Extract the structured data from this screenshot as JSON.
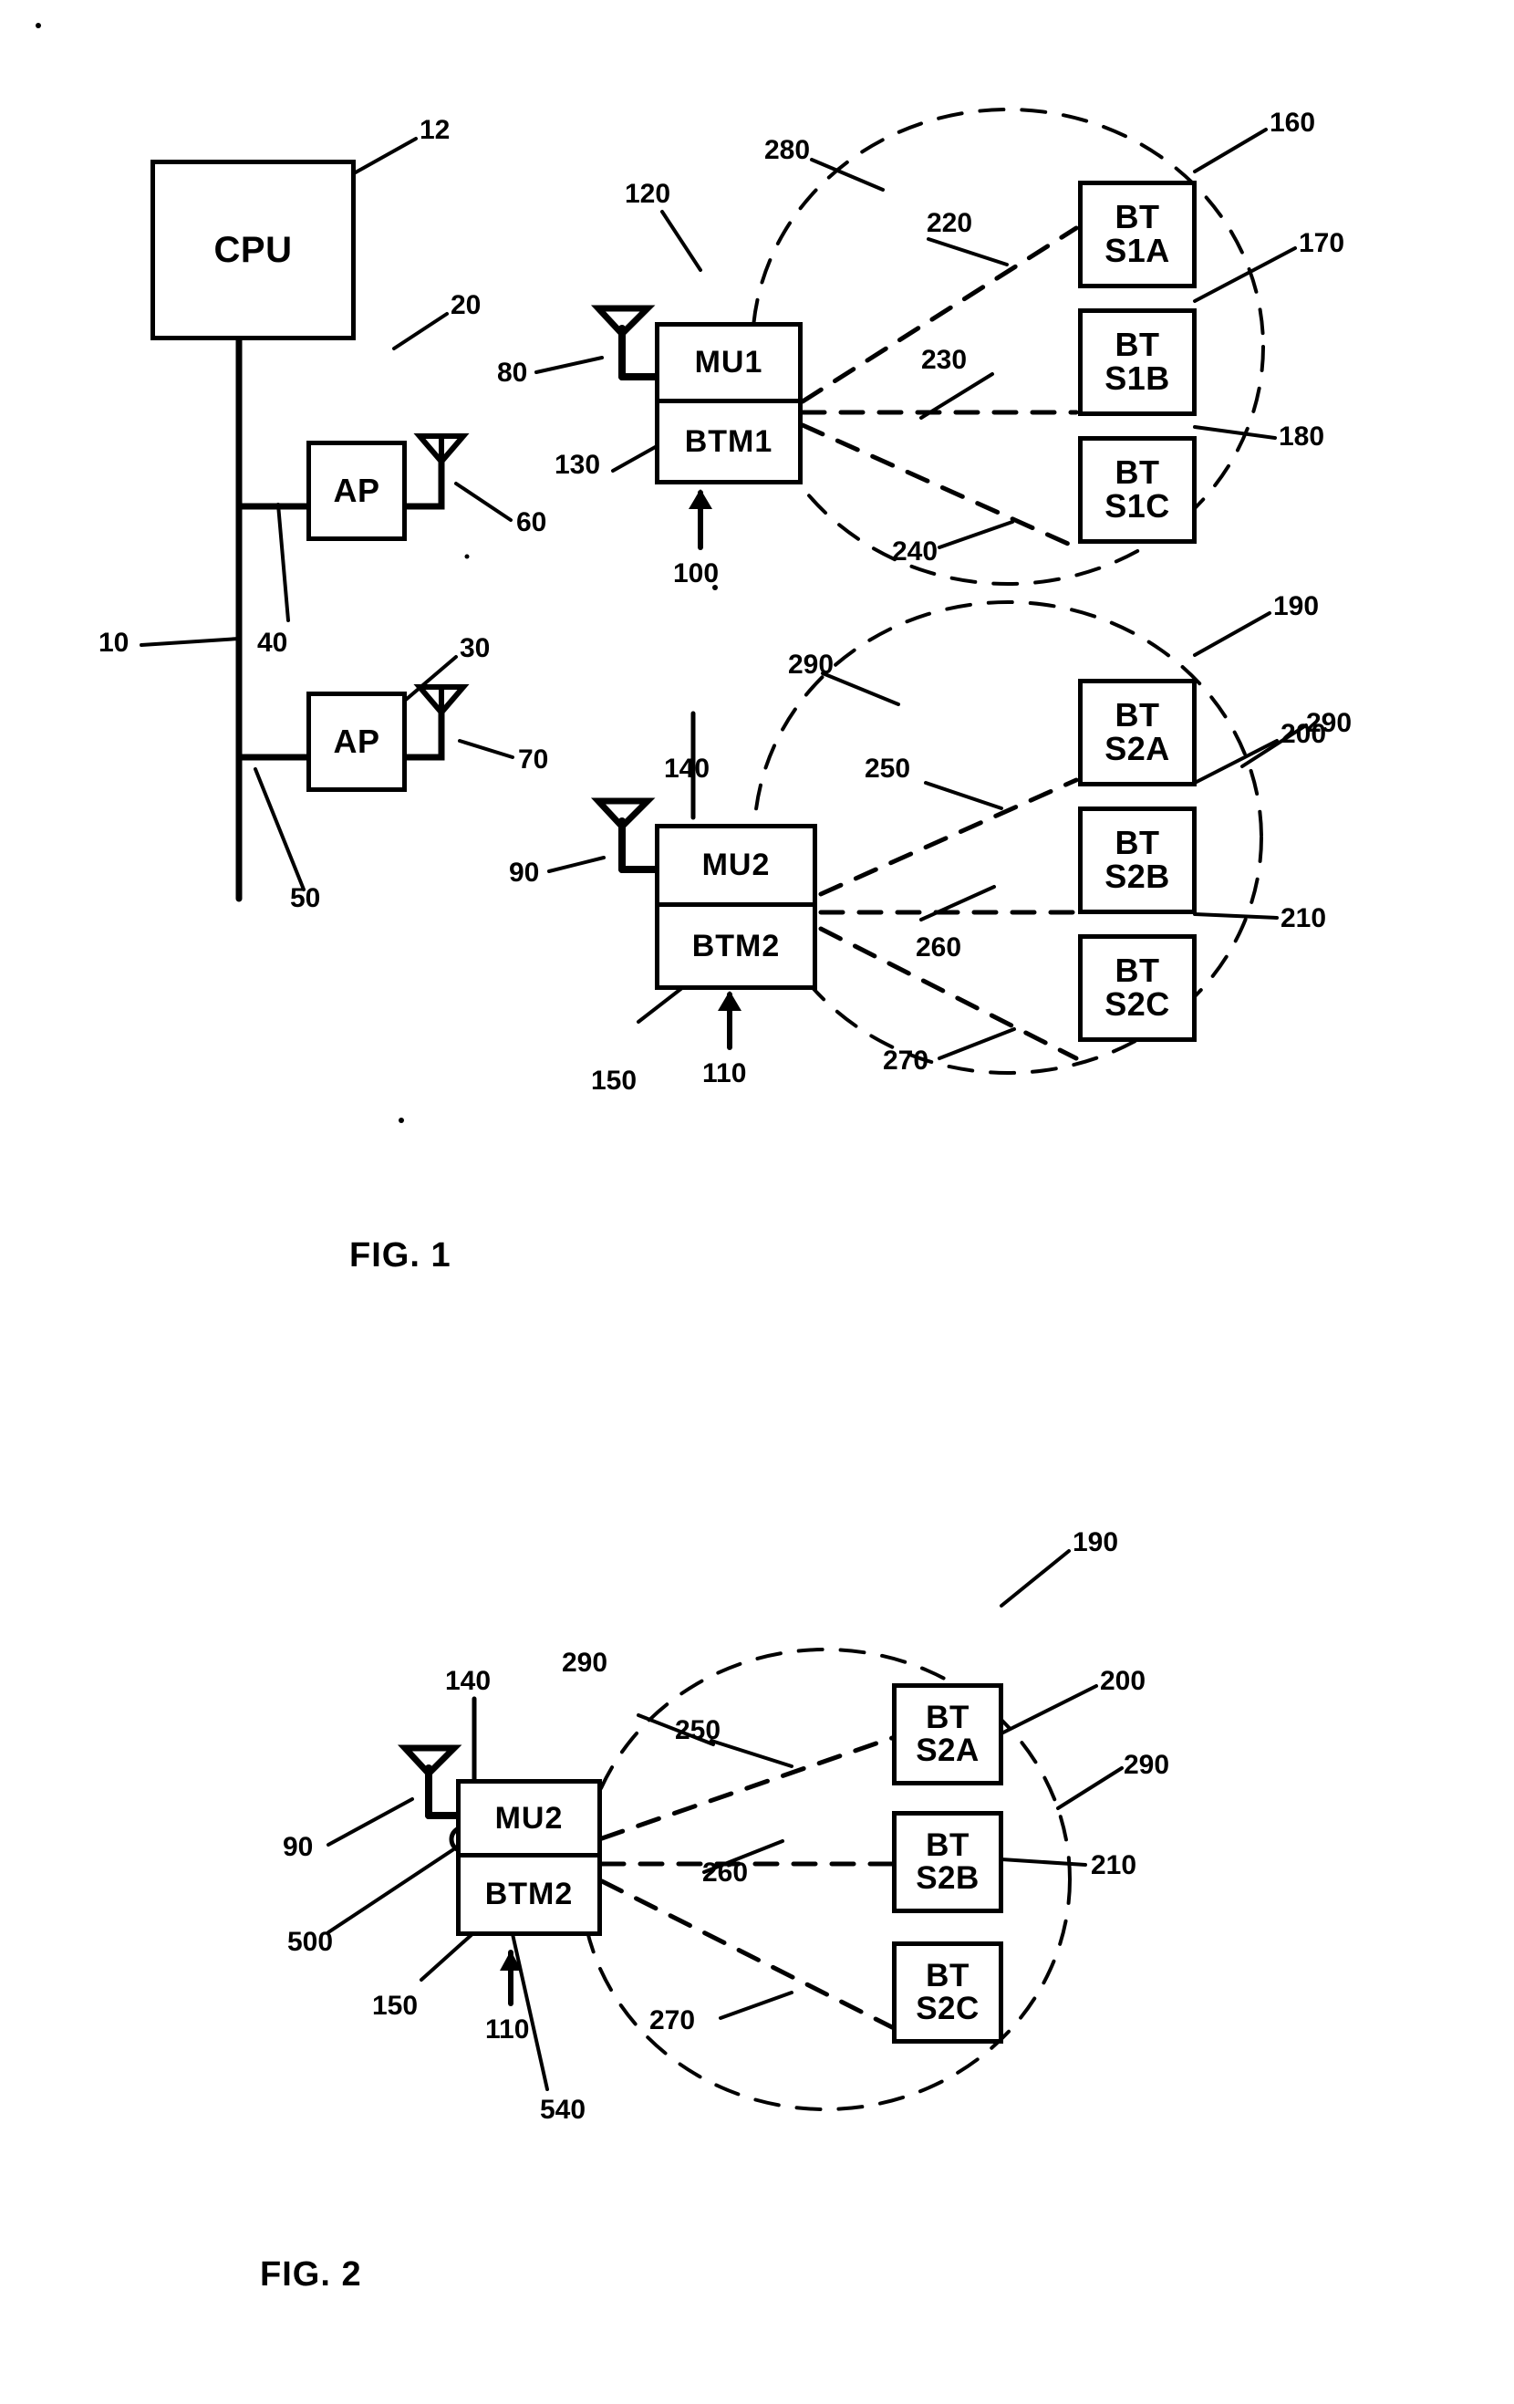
{
  "document": {
    "type": "patent-drawing-sheet",
    "figures": [
      {
        "caption": "FIG. 1",
        "blocks": {
          "cpu": "CPU",
          "ap1": "AP",
          "ap2": "AP",
          "mu1_top": "MU1",
          "mu1_bottom": "BTM1",
          "mu2_top": "MU2",
          "mu2_bottom": "BTM2",
          "bt_s1a_line1": "BT",
          "bt_s1a_line2": "S1A",
          "bt_s1b_line1": "BT",
          "bt_s1b_line2": "S1B",
          "bt_s1c_line1": "BT",
          "bt_s1c_line2": "S1C",
          "bt_s2a_line1": "BT",
          "bt_s2a_line2": "S2A",
          "bt_s2b_line1": "BT",
          "bt_s2b_line2": "S2B",
          "bt_s2c_line1": "BT",
          "bt_s2c_line2": "S2C"
        },
        "reference_numerals": {
          "cpu": "12",
          "ap1": "20",
          "ap2": "30",
          "bus": "10",
          "bus_tap_upper": "40",
          "bus_tap_lower": "50",
          "ap1_antenna": "60",
          "ap2_antenna": "70",
          "mu1_antenna": "80",
          "mu2_antenna": "90",
          "btm1_arrow": "100",
          "btm2_arrow": "110",
          "mu1": "120",
          "btm1": "130",
          "mu2": "140",
          "btm2": "150",
          "bt_s1a": "160",
          "bt_s1b": "170",
          "bt_s1c": "180",
          "bt_s2a": "190",
          "bt_s2b": "200",
          "bt_s2c": "210",
          "link_s1a": "220",
          "link_s1b": "230",
          "link_s1c": "240",
          "link_s2a": "250",
          "link_s2b": "260",
          "link_s2c": "270",
          "piconet1": "280",
          "piconet2_upper": "290",
          "piconet2_right": "290",
          "piconet2_lower": "290"
        }
      },
      {
        "caption": "FIG. 2",
        "blocks": {
          "mu2_top": "MU2",
          "mu2_bottom": "BTM2",
          "bt_s2a_line1": "BT",
          "bt_s2a_line2": "S2A",
          "bt_s2b_line1": "BT",
          "bt_s2b_line2": "S2B",
          "bt_s2c_line1": "BT",
          "bt_s2c_line2": "S2C"
        },
        "reference_numerals": {
          "mu2_antenna": "90",
          "btm2_arrow": "110",
          "mu2": "140",
          "btm2": "150",
          "bt_s2a": "190",
          "bt_s2b": "200",
          "bt_s2c": "210",
          "link_s2a": "250",
          "link_s2b": "260",
          "link_s2c": "270",
          "piconet_upper": "290",
          "piconet_right": "290",
          "interface_500": "500",
          "interface_540": "540"
        }
      }
    ]
  },
  "colors": {
    "ink": "#000000",
    "paper": "#ffffff"
  }
}
